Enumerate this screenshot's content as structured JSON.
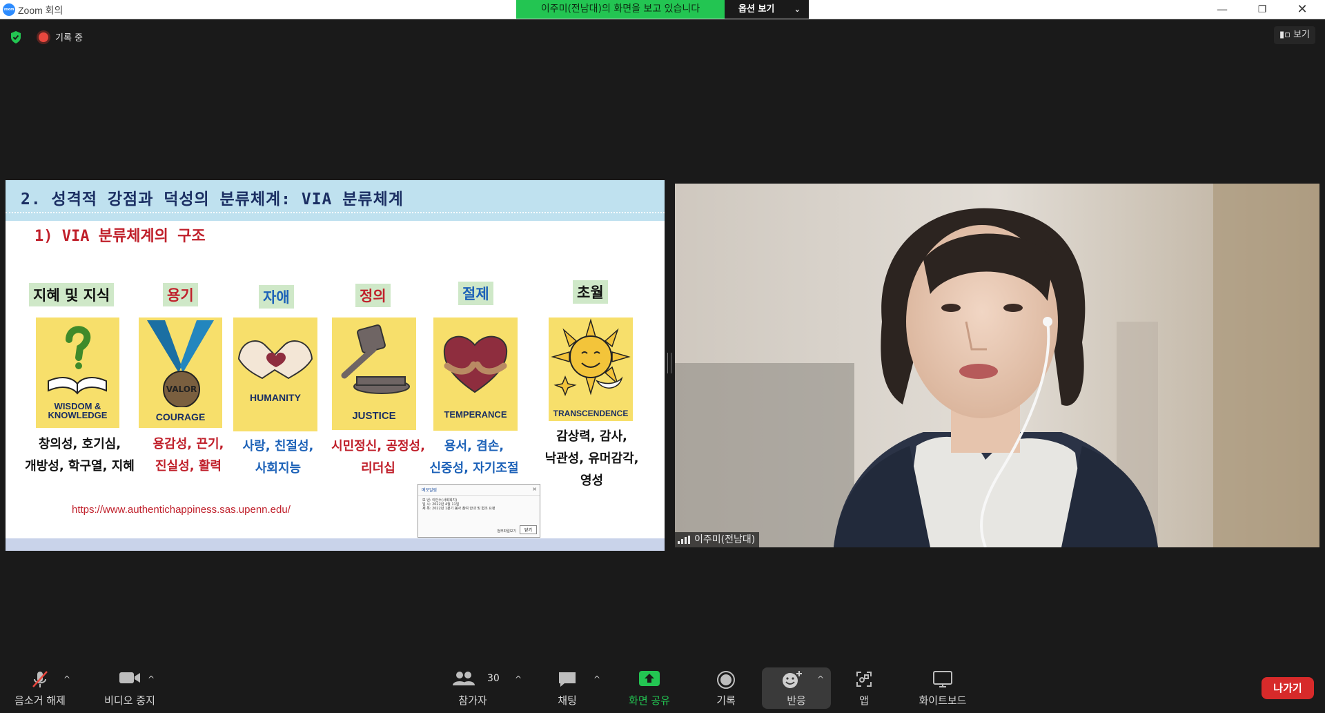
{
  "window": {
    "title": "Zoom 회의",
    "logo_text": "zoom",
    "minimize": "—",
    "restore": "❐",
    "close": "✕"
  },
  "share_banner": {
    "text": "이주미(전남대)의 화면을 보고 있습니다",
    "options_label": "옵션 보기",
    "options_chevron": "⌄"
  },
  "top_bar": {
    "recording_label": "기록 중",
    "view_label": "보기"
  },
  "slide": {
    "title": "2. 성격적 강점과 덕성의 분류체계: VIA 분류체계",
    "subtitle": "1) VIA 분류체계의 구조",
    "url": "https://www.authentichappiness.sas.upenn.edu/",
    "virtues": [
      {
        "name": "지혜 및 지식",
        "card_label_1": "WISDOM &",
        "card_label_2": "KNOWLEDGE",
        "strengths_1": "창의성, 호기심,",
        "strengths_2": "개방성, 학구열, 지혜",
        "color": "#111111"
      },
      {
        "name": "용기",
        "card_label_1": "COURAGE",
        "card_label_2": "",
        "strengths_1": "용감성, 끈기,",
        "strengths_2": "진실성, 활력",
        "color": "#c0202b"
      },
      {
        "name": "자애",
        "card_label_1": "HUMANITY",
        "card_label_2": "",
        "strengths_1": "사랑, 친절성,",
        "strengths_2": "사회지능",
        "color": "#1d62b8"
      },
      {
        "name": "정의",
        "card_label_1": "JUSTICE",
        "card_label_2": "",
        "strengths_1": "시민정신, 공정성,",
        "strengths_2": "리더십",
        "color": "#c0202b"
      },
      {
        "name": "절제",
        "card_label_1": "TEMPERANCE",
        "card_label_2": "",
        "strengths_1": "용서, 겸손,",
        "strengths_2": "신중성, 자기조절",
        "color": "#1d62b8"
      },
      {
        "name": "초월",
        "card_label_1": "TRANSCENDENCE",
        "card_label_2": "",
        "strengths_1": "감상력, 감사,",
        "strengths_2": "낙관성, 유머감각,",
        "strengths_3": "영성",
        "color": "#111111"
      }
    ],
    "popup": {
      "title": "메모알림",
      "close": "×",
      "line1": "보 낸: 이인수(사회복지)",
      "line2": "일 시: 2022년 4월 11일",
      "line3": "제 목: 2022년 1분기 봉사 참여 안내 및 협조 요청",
      "link": "첨부파일보기",
      "button": "닫기"
    }
  },
  "video": {
    "participant_name": "이주미(전남대)"
  },
  "toolbar": {
    "mute": "음소거 해제",
    "video": "비디오 중지",
    "participants": "참가자",
    "participant_count": "30",
    "chat": "채팅",
    "share": "화면 공유",
    "record": "기록",
    "reaction": "반응",
    "apps": "앱",
    "whiteboard": "화이트보드",
    "leave": "나가기",
    "caret": "^"
  },
  "colors": {
    "share_green": "#23c552",
    "leave_red": "#d72a2a",
    "slide_header": "#bfe1ef",
    "card_yellow": "#f7df6b"
  }
}
